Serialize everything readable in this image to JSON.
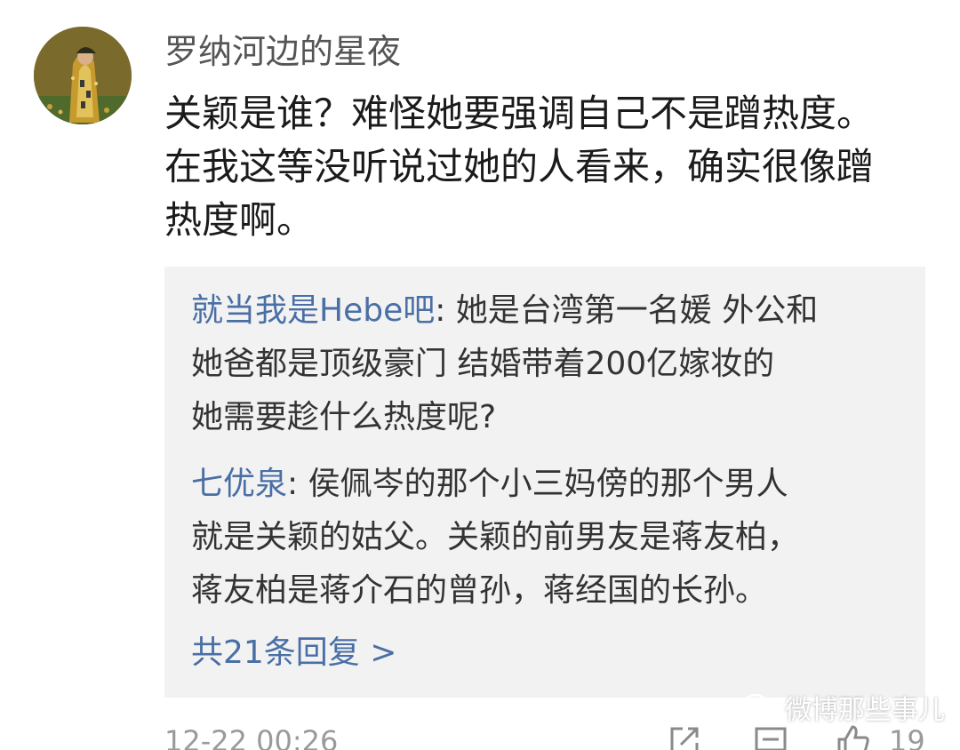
{
  "comment": {
    "username": "罗纳河边的星夜",
    "text": "关颖是谁？难怪她要强调自己不是蹭热度。\n在我这等没听说过她的人看来，确实很像蹭\n热度啊。",
    "avatar_icon": "painting-avatar-icon"
  },
  "replies": [
    {
      "author": "就当我是Hebe吧",
      "text": ": 她是台湾第一名媛 外公和\n她爸都是顶级豪门 结婚带着200亿嫁妆的\n她需要趁什么热度呢?"
    },
    {
      "author": "七优泉",
      "text": ": 侯佩岑的那个小三妈傍的那个男人\n就是关颖的姑父。关颖的前男友是蒋友柏，\n蒋友柏是蒋介石的曾孙，蒋经国的长孙。"
    }
  ],
  "more_replies_label": "共21条回复 >",
  "footer": {
    "timestamp": "12-22 00:26",
    "like_count": "19",
    "share_icon": "share-icon",
    "comment_icon": "comment-icon",
    "like_icon": "thumbs-up-icon"
  },
  "watermark": {
    "label": "微博那些事儿",
    "icon": "wechat-icon"
  },
  "colors": {
    "link_blue": "#4a6fa5",
    "reply_bg": "#f2f2f2",
    "meta_gray": "#9a9a9a"
  }
}
